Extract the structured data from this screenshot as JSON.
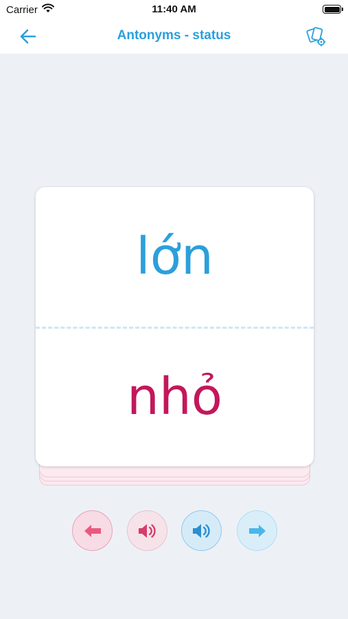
{
  "status_bar": {
    "carrier": "Carrier",
    "time": "11:40 AM",
    "icons": [
      "wifi-icon",
      "battery-icon"
    ]
  },
  "nav": {
    "title": "Antonyms - status",
    "back_icon": "arrow-left-icon",
    "settings_icon": "cards-settings-icon"
  },
  "card": {
    "word_top": "lớn",
    "word_bottom": "nhỏ"
  },
  "controls": {
    "prev_icon": "arrow-left-icon",
    "speak_pink_icon": "speaker-icon",
    "speak_blue_icon": "speaker-icon",
    "next_icon": "arrow-right-icon"
  },
  "colors": {
    "accent_blue": "#2a9fdc",
    "accent_pink": "#c2185b",
    "background": "#edf1f6"
  }
}
